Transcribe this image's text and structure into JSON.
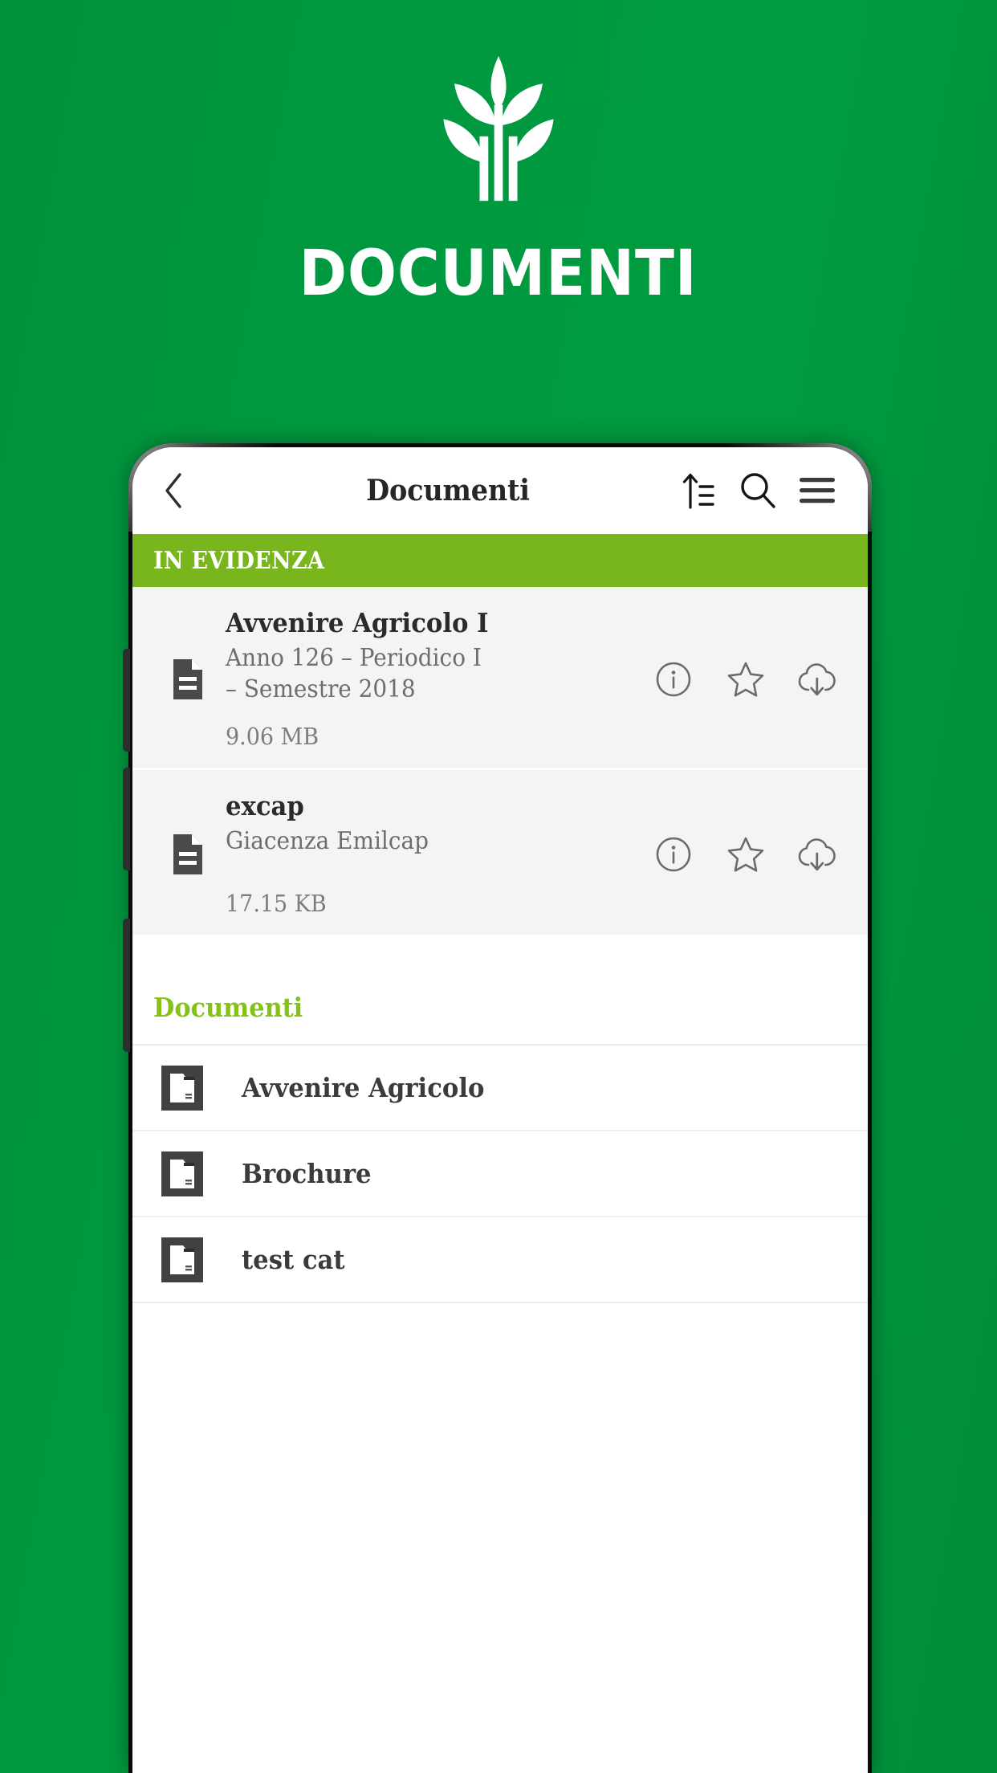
{
  "promo": {
    "title": "DOCUMENTI",
    "logo_icon": "wheat-plant-logo",
    "background_color": "#009639",
    "title_color": "#ffffff"
  },
  "phone": {
    "speaker_icon": "speaker-grille"
  },
  "appbar": {
    "back_icon": "chevron-left-icon",
    "title": "Documenti",
    "sort_icon": "sort-ascending-icon",
    "search_icon": "search-icon",
    "menu_icon": "hamburger-menu-icon"
  },
  "featured": {
    "header_label": "IN EVIDENZA",
    "header_color": "#79b51c",
    "documents": [
      {
        "title": "Avvenire Agricolo I",
        "subtitle": "Anno 126 – Periodico I – Semestre 2018",
        "size": "9.06 MB",
        "file_icon": "document-file-icon",
        "info_icon": "info-circle-icon",
        "favorite_icon": "star-outline-icon",
        "download_icon": "cloud-download-icon"
      },
      {
        "title": "excap",
        "subtitle": "Giacenza Emilcap",
        "size": "17.15 KB",
        "file_icon": "document-file-icon",
        "info_icon": "info-circle-icon",
        "favorite_icon": "star-outline-icon",
        "download_icon": "cloud-download-icon"
      }
    ]
  },
  "folders_section": {
    "header_label": "Documenti",
    "header_color": "#86c118",
    "items": [
      {
        "label": "Avvenire Agricolo",
        "icon": "folder-icon"
      },
      {
        "label": "Brochure",
        "icon": "folder-icon"
      },
      {
        "label": "test cat",
        "icon": "folder-icon"
      }
    ]
  }
}
